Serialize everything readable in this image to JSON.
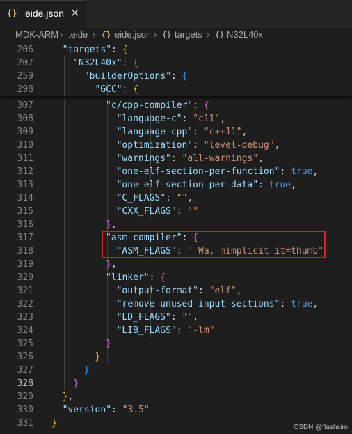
{
  "tab": {
    "icon": "{}",
    "label": "eide.json",
    "close": "✕"
  },
  "breadcrumb": [
    "MDK-ARM",
    ".eide",
    "eide.json",
    "targets",
    "N32L40x"
  ],
  "sticky_lines": [
    {
      "n": "206",
      "tokens": [
        [
          "k",
          "\"targets\""
        ],
        [
          "p",
          ": "
        ],
        [
          "b1",
          "{"
        ]
      ],
      "indent": 1
    },
    {
      "n": "207",
      "tokens": [
        [
          "k",
          "\"N32L40x\""
        ],
        [
          "p",
          ": "
        ],
        [
          "b2",
          "{"
        ]
      ],
      "indent": 2
    },
    {
      "n": "259",
      "tokens": [
        [
          "k",
          "\"builderOptions\""
        ],
        [
          "p",
          ": "
        ],
        [
          "b3",
          "{"
        ]
      ],
      "indent": 3
    },
    {
      "n": "298",
      "tokens": [
        [
          "k",
          "\"GCC\""
        ],
        [
          "p",
          ": "
        ],
        [
          "b1",
          "{"
        ]
      ],
      "indent": 4
    }
  ],
  "lines": [
    {
      "n": "307",
      "tokens": [
        [
          "k",
          "\"c/cpp-compiler\""
        ],
        [
          "p",
          ": "
        ],
        [
          "b2",
          "{"
        ]
      ],
      "indent": 5
    },
    {
      "n": "308",
      "tokens": [
        [
          "k",
          "\"language-c\""
        ],
        [
          "p",
          ": "
        ],
        [
          "s",
          "\"c11\""
        ],
        [
          "p",
          ","
        ]
      ],
      "indent": 6
    },
    {
      "n": "309",
      "tokens": [
        [
          "k",
          "\"language-cpp\""
        ],
        [
          "p",
          ": "
        ],
        [
          "s",
          "\"c++11\""
        ],
        [
          "p",
          ","
        ]
      ],
      "indent": 6
    },
    {
      "n": "310",
      "tokens": [
        [
          "k",
          "\"optimization\""
        ],
        [
          "p",
          ": "
        ],
        [
          "s",
          "\"level-debug\""
        ],
        [
          "p",
          ","
        ]
      ],
      "indent": 6
    },
    {
      "n": "311",
      "tokens": [
        [
          "k",
          "\"warnings\""
        ],
        [
          "p",
          ": "
        ],
        [
          "s",
          "\"all-warnings\""
        ],
        [
          "p",
          ","
        ]
      ],
      "indent": 6
    },
    {
      "n": "312",
      "tokens": [
        [
          "k",
          "\"one-elf-section-per-function\""
        ],
        [
          "p",
          ": "
        ],
        [
          "c",
          "true"
        ],
        [
          "p",
          ","
        ]
      ],
      "indent": 6
    },
    {
      "n": "313",
      "tokens": [
        [
          "k",
          "\"one-elf-section-per-data\""
        ],
        [
          "p",
          ": "
        ],
        [
          "c",
          "true"
        ],
        [
          "p",
          ","
        ]
      ],
      "indent": 6
    },
    {
      "n": "314",
      "tokens": [
        [
          "k",
          "\"C_FLAGS\""
        ],
        [
          "p",
          ": "
        ],
        [
          "s",
          "\"\""
        ],
        [
          "p",
          ","
        ]
      ],
      "indent": 6
    },
    {
      "n": "315",
      "tokens": [
        [
          "k",
          "\"CXX_FLAGS\""
        ],
        [
          "p",
          ": "
        ],
        [
          "s",
          "\"\""
        ]
      ],
      "indent": 6
    },
    {
      "n": "316",
      "tokens": [
        [
          "b2",
          "}"
        ],
        [
          "p",
          ","
        ]
      ],
      "indent": 5
    },
    {
      "n": "317",
      "tokens": [
        [
          "k",
          "\"asm-compiler\""
        ],
        [
          "p",
          ": "
        ],
        [
          "b2",
          "{"
        ]
      ],
      "indent": 5
    },
    {
      "n": "318",
      "tokens": [
        [
          "k",
          "\"ASM_FLAGS\""
        ],
        [
          "p",
          ": "
        ],
        [
          "s",
          "\"-Wa,-mimplicit-it=thumb\""
        ]
      ],
      "indent": 6
    },
    {
      "n": "319",
      "tokens": [
        [
          "b2",
          "}"
        ],
        [
          "p",
          ","
        ]
      ],
      "indent": 5
    },
    {
      "n": "320",
      "tokens": [
        [
          "k",
          "\"linker\""
        ],
        [
          "p",
          ": "
        ],
        [
          "b2",
          "{"
        ]
      ],
      "indent": 5
    },
    {
      "n": "321",
      "tokens": [
        [
          "k",
          "\"output-format\""
        ],
        [
          "p",
          ": "
        ],
        [
          "s",
          "\"elf\""
        ],
        [
          "p",
          ","
        ]
      ],
      "indent": 6
    },
    {
      "n": "322",
      "tokens": [
        [
          "k",
          "\"remove-unused-input-sections\""
        ],
        [
          "p",
          ": "
        ],
        [
          "c",
          "true"
        ],
        [
          "p",
          ","
        ]
      ],
      "indent": 6
    },
    {
      "n": "323",
      "tokens": [
        [
          "k",
          "\"LD_FLAGS\""
        ],
        [
          "p",
          ": "
        ],
        [
          "s",
          "\"\""
        ],
        [
          "p",
          ","
        ]
      ],
      "indent": 6
    },
    {
      "n": "324",
      "tokens": [
        [
          "k",
          "\"LIB_FLAGS\""
        ],
        [
          "p",
          ": "
        ],
        [
          "s",
          "\"-lm\""
        ]
      ],
      "indent": 6
    },
    {
      "n": "325",
      "tokens": [
        [
          "b2",
          "}"
        ]
      ],
      "indent": 5
    },
    {
      "n": "326",
      "tokens": [
        [
          "b1",
          "}"
        ]
      ],
      "indent": 4
    },
    {
      "n": "327",
      "tokens": [
        [
          "b3",
          "}"
        ]
      ],
      "indent": 3
    },
    {
      "n": "328",
      "tokens": [
        [
          "b2",
          "}"
        ]
      ],
      "indent": 2,
      "active": true
    },
    {
      "n": "329",
      "tokens": [
        [
          "b1",
          "}"
        ],
        [
          "p",
          ","
        ]
      ],
      "indent": 1
    },
    {
      "n": "330",
      "tokens": [
        [
          "k",
          "\"version\""
        ],
        [
          "p",
          ": "
        ],
        [
          "s",
          "\"3.5\""
        ]
      ],
      "indent": 1
    },
    {
      "n": "331",
      "tokens": [
        [
          "b1",
          "}"
        ]
      ],
      "indent": 0
    }
  ],
  "watermark": "CSDN @flashsim"
}
